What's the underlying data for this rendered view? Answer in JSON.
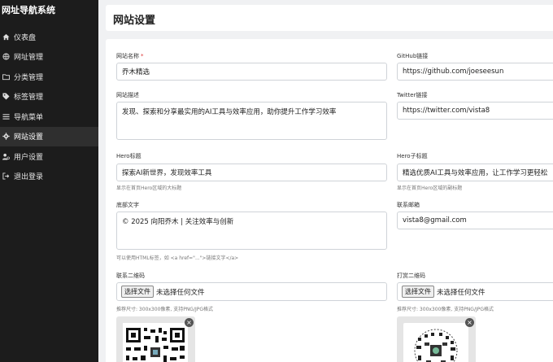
{
  "sidebar": {
    "brand": "网址导航系统",
    "items": [
      {
        "label": "仪表盘",
        "icon": "home-icon"
      },
      {
        "label": "网址管理",
        "icon": "globe-icon"
      },
      {
        "label": "分类管理",
        "icon": "folder-icon"
      },
      {
        "label": "标签管理",
        "icon": "tag-icon"
      },
      {
        "label": "导航菜单",
        "icon": "menu-icon"
      },
      {
        "label": "网站设置",
        "icon": "gear-icon",
        "active": true
      },
      {
        "label": "用户设置",
        "icon": "user-cog-icon"
      },
      {
        "label": "退出登录",
        "icon": "logout-icon"
      }
    ]
  },
  "header": {
    "title": "网站设置"
  },
  "form": {
    "site_name": {
      "label": "网站名称",
      "required": "*",
      "value": "乔木精选"
    },
    "github": {
      "label": "GitHub链接",
      "value": "https://github.com/joeseesun"
    },
    "description": {
      "label": "网站描述",
      "value": "发现、探索和分享最实用的AI工具与效率应用，助你提升工作学习效率"
    },
    "twitter": {
      "label": "Twitter链接",
      "value": "https://twitter.com/vista8"
    },
    "hero_title": {
      "label": "Hero标题",
      "value": "探索AI新世界，发现效率工具",
      "hint": "显示在首页Hero区域的大标题"
    },
    "hero_subtitle": {
      "label": "Hero子标题",
      "value": "精选优质AI工具与效率应用，让工作学习更轻松",
      "hint": "显示在首页Hero区域的副标题"
    },
    "footer": {
      "label": "底部文字",
      "value": "© 2025 向阳乔木 | 关注效率与创新",
      "hint": "可以使用HTML标签，如 <a href=\"...\">链接文字</a>"
    },
    "email": {
      "label": "联系邮箱",
      "value": "vista8@gmail.com"
    },
    "contact_qr": {
      "label": "联系二维码",
      "button": "选择文件",
      "file_text": "未选择任何文件",
      "hint": "推荐尺寸: 300x300像素, 支持PNG/JPG格式"
    },
    "reward_qr": {
      "label": "打赏二维码",
      "button": "选择文件",
      "file_text": "未选择任何文件",
      "hint": "推荐尺寸: 300x300像素, 支持PNG/JPG格式"
    },
    "close_glyph": "×"
  }
}
